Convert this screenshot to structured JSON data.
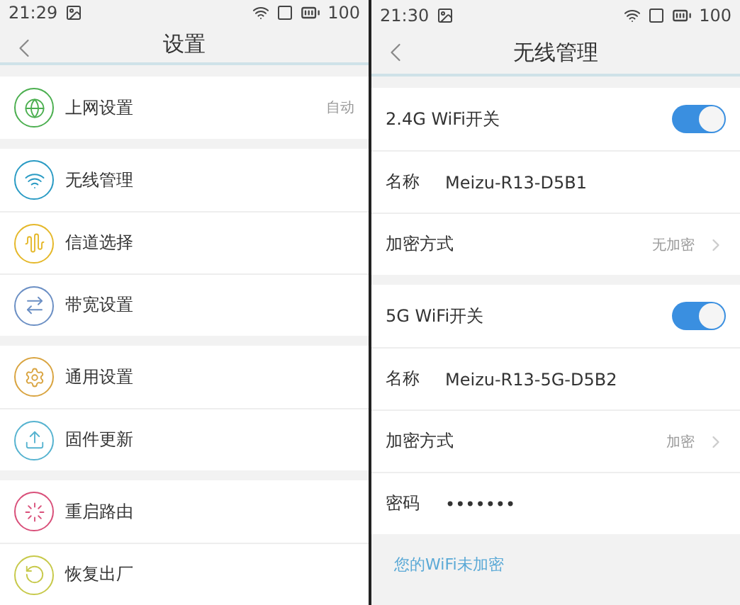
{
  "screens": [
    {
      "status_bar": {
        "time": "21:29",
        "battery": "100"
      },
      "title": "设置",
      "groups": [
        [
          {
            "label": "上网设置",
            "value": "自动"
          }
        ],
        [
          {
            "label": "无线管理"
          },
          {
            "label": "信道选择"
          },
          {
            "label": "带宽设置"
          }
        ],
        [
          {
            "label": "通用设置"
          },
          {
            "label": "固件更新"
          }
        ],
        [
          {
            "label": "重启路由"
          },
          {
            "label": "恢复出厂"
          }
        ]
      ]
    },
    {
      "status_bar": {
        "time": "21:30",
        "battery": "100"
      },
      "title": "无线管理",
      "groups": [
        [
          {
            "kind": "switch",
            "label": "2.4G WiFi开关",
            "on": true
          },
          {
            "kind": "field",
            "label": "名称",
            "value": "Meizu-R13-D5B1"
          },
          {
            "kind": "select",
            "label": "加密方式",
            "value": "无加密"
          }
        ],
        [
          {
            "kind": "switch",
            "label": "5G WiFi开关",
            "on": true
          },
          {
            "kind": "field",
            "label": "名称",
            "value": "Meizu-R13-5G-D5B2"
          },
          {
            "kind": "select",
            "label": "加密方式",
            "value": "加密"
          },
          {
            "kind": "field",
            "label": "密码",
            "value": "•••••••"
          }
        ]
      ],
      "tip": "您的WiFi未加密"
    }
  ]
}
